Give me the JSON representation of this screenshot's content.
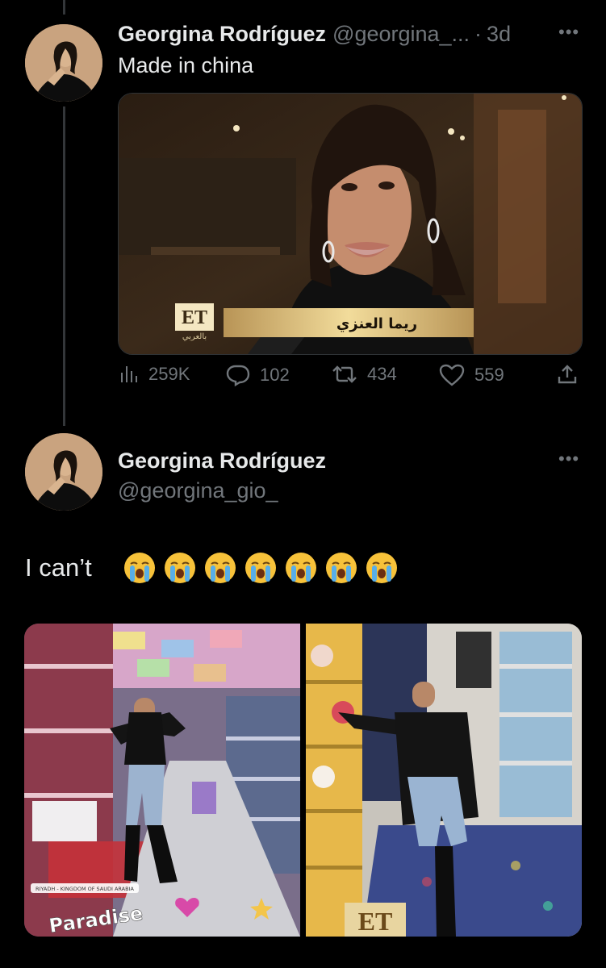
{
  "tweet1": {
    "author_name": "Georgina Rodríguez",
    "handle": "@georgina_...",
    "separator": "·",
    "time": "3d",
    "more_icon": "more-icon",
    "text": "Made in china",
    "media": {
      "logo_text": "ET",
      "logo_sub": "بالعربي",
      "caption": "ريما العنزي"
    },
    "metrics": {
      "views": "259K",
      "replies": "102",
      "reposts": "434",
      "likes": "559"
    }
  },
  "tweet2": {
    "author_name": "Georgina Rodríguez",
    "handle": "@georgina_gio_",
    "more_icon": "more-icon",
    "text": "I can’t",
    "emoji_count": 7,
    "media": {
      "left_tag": "RIYADH - KINGDOM OF SAUDI ARABIA",
      "left_sticker": "Paradise",
      "right_logo": "ET"
    }
  },
  "colors": {
    "background": "#000000",
    "text": "#e7e9ea",
    "secondary": "#71767b",
    "thread_line": "#333639"
  }
}
